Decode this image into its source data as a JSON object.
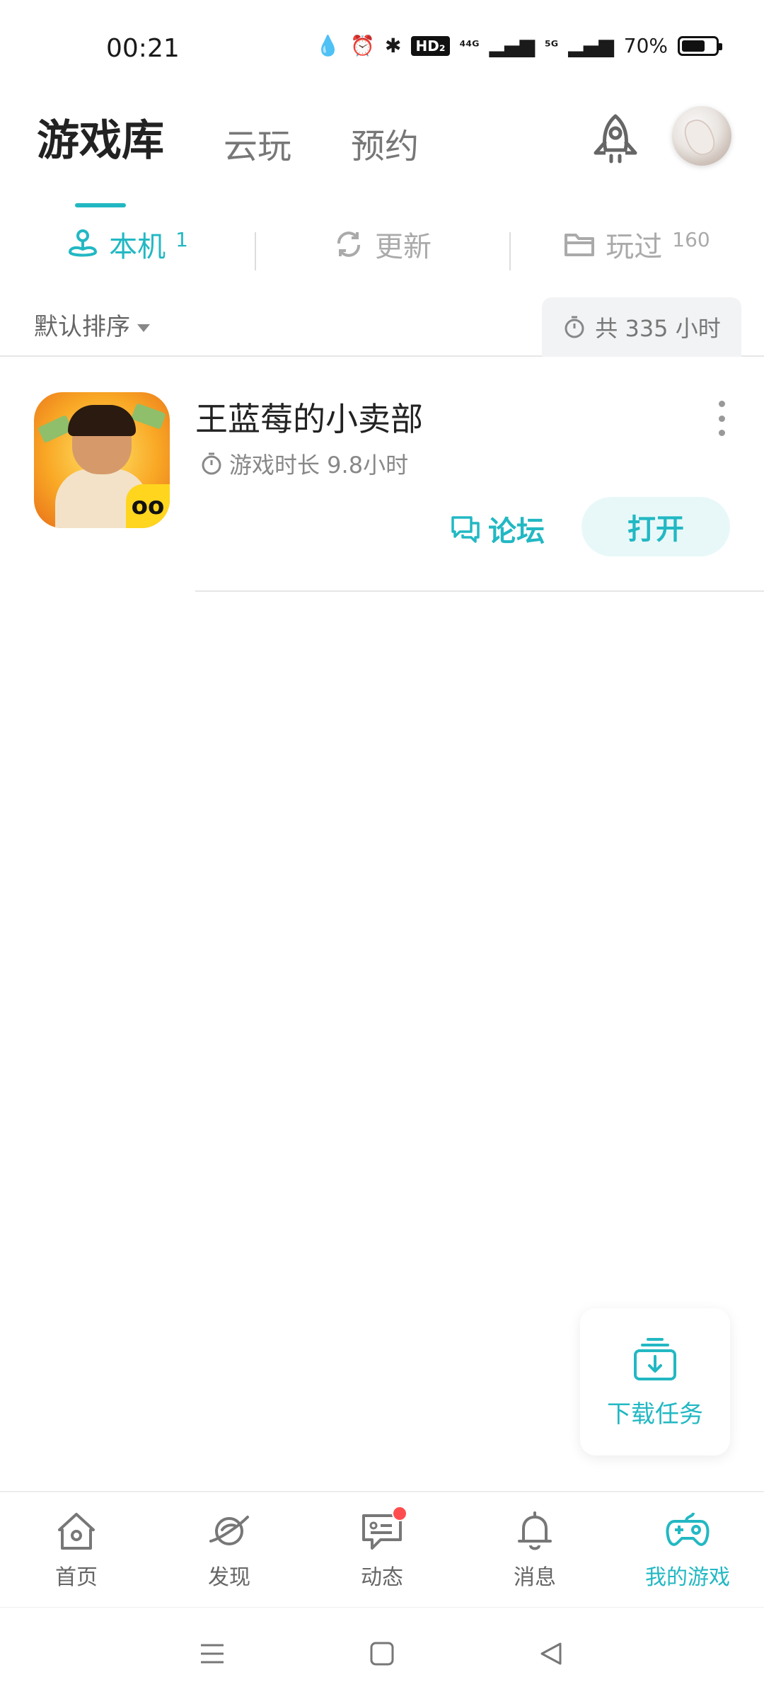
{
  "status_bar": {
    "time": "00:21",
    "hd_label": "HD₂",
    "net_1": "⁴⁴ᴳ",
    "net_2": "⁵ᴳ",
    "battery": "70%",
    "battery_level": 0.7
  },
  "header": {
    "tabs": [
      {
        "label": "游戏库",
        "active": true
      },
      {
        "label": "云玩",
        "active": false
      },
      {
        "label": "预约",
        "active": false
      }
    ]
  },
  "sub_tabs": [
    {
      "label": "本机",
      "count": "1",
      "icon": "joystick-icon",
      "active": true
    },
    {
      "label": "更新",
      "count": "",
      "icon": "refresh-icon",
      "active": false
    },
    {
      "label": "玩过",
      "count": "160",
      "icon": "folder-icon",
      "active": false
    }
  ],
  "sort": {
    "label": "默认排序",
    "total_time": "共 335 小时"
  },
  "games": [
    {
      "title": "王蓝莓的小卖部",
      "play_time": "游戏时长 9.8小时",
      "badge": "oo",
      "forum_label": "论坛",
      "open_label": "打开"
    }
  ],
  "download_task": {
    "label": "下载任务"
  },
  "bottom_nav": [
    {
      "label": "首页",
      "icon": "home-icon",
      "active": false
    },
    {
      "label": "发现",
      "icon": "planet-icon",
      "active": false
    },
    {
      "label": "动态",
      "icon": "chat-icon",
      "active": false,
      "badge_dot": true
    },
    {
      "label": "消息",
      "icon": "bell-icon",
      "active": false
    },
    {
      "label": "我的游戏",
      "icon": "gamepad-icon",
      "active": true
    }
  ],
  "colors": {
    "accent": "#22b8c3",
    "accent_light": "#e8f8f9",
    "badge_red": "#ff4d4f"
  }
}
